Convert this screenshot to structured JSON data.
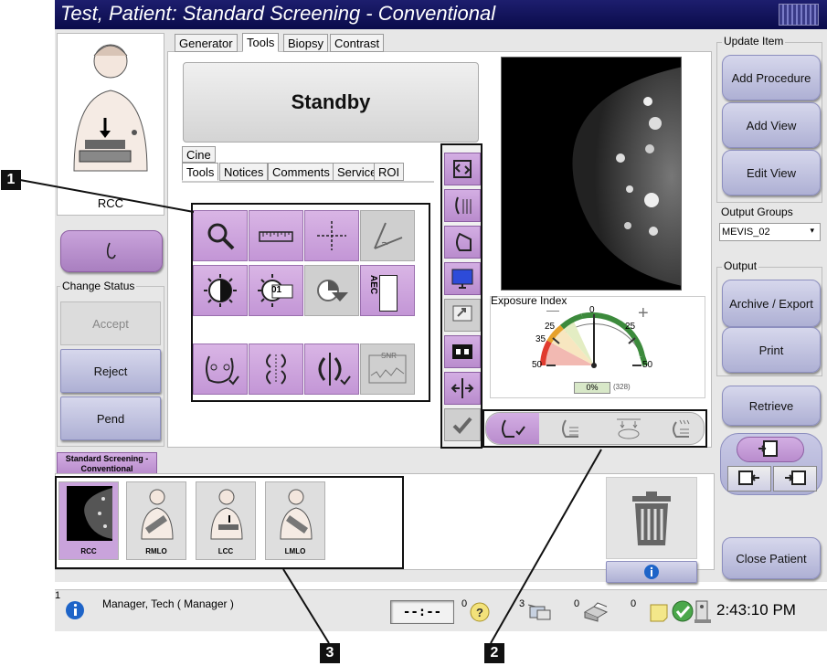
{
  "window": {
    "title": "Test, Patient:  Standard Screening - Conventional"
  },
  "left_panel": {
    "view_label": "RCC",
    "change_status_label": "Change Status",
    "status_buttons": {
      "accept": "Accept",
      "reject": "Reject",
      "pend": "Pend"
    }
  },
  "main_tabs": [
    "Generator",
    "Tools",
    "Biopsy",
    "Contrast"
  ],
  "standby_label": "Standby",
  "cine_tab": "Cine",
  "sub_tabs": [
    "Tools",
    "Notices",
    "Comments",
    "Service",
    "ROI"
  ],
  "tool_icons": {
    "row1": [
      "magnifier-icon",
      "ruler-icon",
      "crosshair-icon",
      "angle-measure-icon"
    ],
    "row2": [
      "invert-icon",
      "windowing-preset-icon",
      "window-level-icon",
      "aec-sensor-icon"
    ],
    "row3": [
      "implant-present-icon",
      "breast-symmetry-icon",
      "split-view-icon",
      "snr-graph-icon"
    ],
    "aec_text": "AEC",
    "preset_text": "01",
    "snr_text": "SNR"
  },
  "exposure": {
    "title": "Exposure Index",
    "scale_labels": [
      "0",
      "25",
      "25",
      "35",
      "50",
      "50"
    ],
    "value": "0%",
    "extra": "(328)",
    "minus_symbol": "—",
    "plus_symbol": "+"
  },
  "right_panel": {
    "update_item_label": "Update Item",
    "add_procedure": "Add Procedure",
    "add_view": "Add View",
    "edit_view": "Edit View",
    "output_groups_label": "Output Groups",
    "output_group_value": "MEVIS_02",
    "output_label": "Output",
    "archive_export": "Archive / Export",
    "print": "Print",
    "retrieve": "Retrieve",
    "close_patient": "Close Patient"
  },
  "procedure_tab": "Standard Screening - Conventional",
  "thumbnails": [
    "RCC",
    "RMLO",
    "LCC",
    "LMLO"
  ],
  "statusbar": {
    "alarm_count": "1",
    "user": "Manager, Tech ( Manager )",
    "timer": "--:--",
    "counts": [
      "0",
      "3",
      "0",
      "0"
    ],
    "time": "2:43:10 PM"
  },
  "callouts": [
    "1",
    "2",
    "3"
  ],
  "colors": {
    "title_bg": "#0a0b4a",
    "accent_purple": "#c396d6",
    "button_blue": "#aeb0d4"
  }
}
